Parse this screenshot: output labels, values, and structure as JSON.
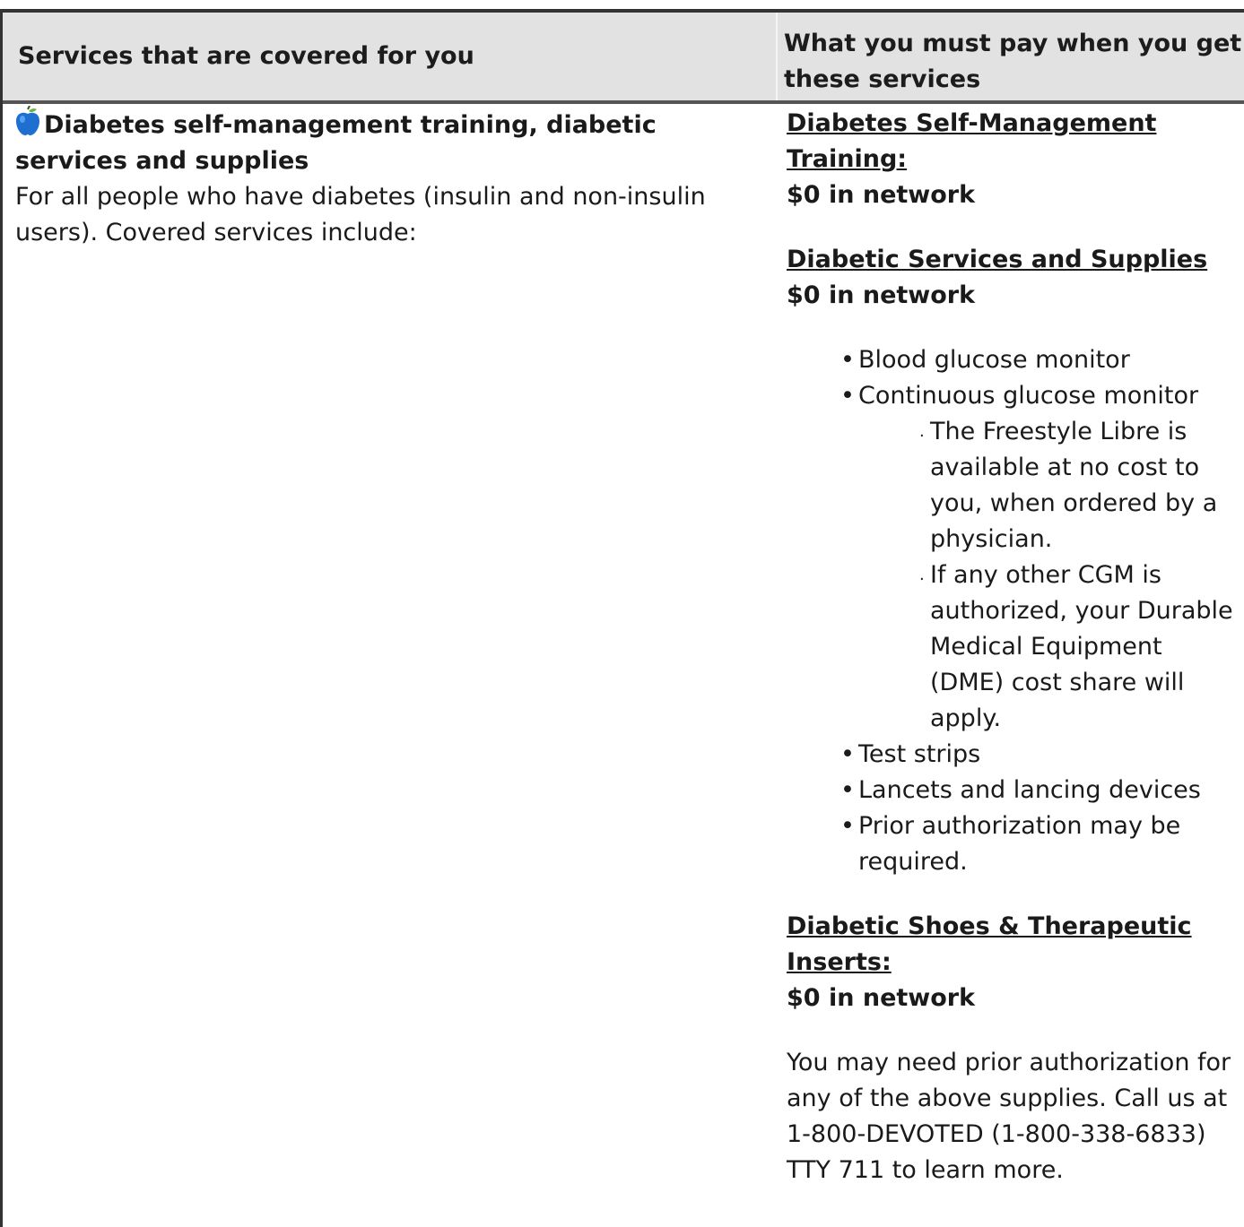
{
  "header": {
    "col_left": "Services that are covered for you",
    "col_right": "What you must pay when you get these services"
  },
  "service": {
    "icon": "apple-icon",
    "title": "Diabetes self-management training, diabetic services and supplies",
    "description": "For all people who have diabetes (insulin and non-insulin users). Covered services include:"
  },
  "cost": {
    "sections": [
      {
        "heading": "Diabetes Self-Management Training:",
        "price": "$0 in network"
      },
      {
        "heading": "Diabetic Services and Supplies",
        "price": "$0 in network"
      },
      {
        "heading": "Diabetic Shoes & Therapeutic Inserts:",
        "price": "$0 in network"
      }
    ],
    "supplies": [
      "Blood glucose monitor",
      "Continuous glucose monitor",
      "Test strips",
      "Lancets and lancing devices",
      "Prior authorization may be required."
    ],
    "cgm_notes": [
      "The Freestyle Libre is available at no cost to you, when ordered by a physician.",
      "If any other CGM is authorized, your Durable Medical Equipment (DME) cost share will apply."
    ],
    "footer_note": "You may need prior authorization for any of the above supplies. Call us at 1-800-DEVOTED (1-800-338-6833) TTY 711 to learn more."
  }
}
